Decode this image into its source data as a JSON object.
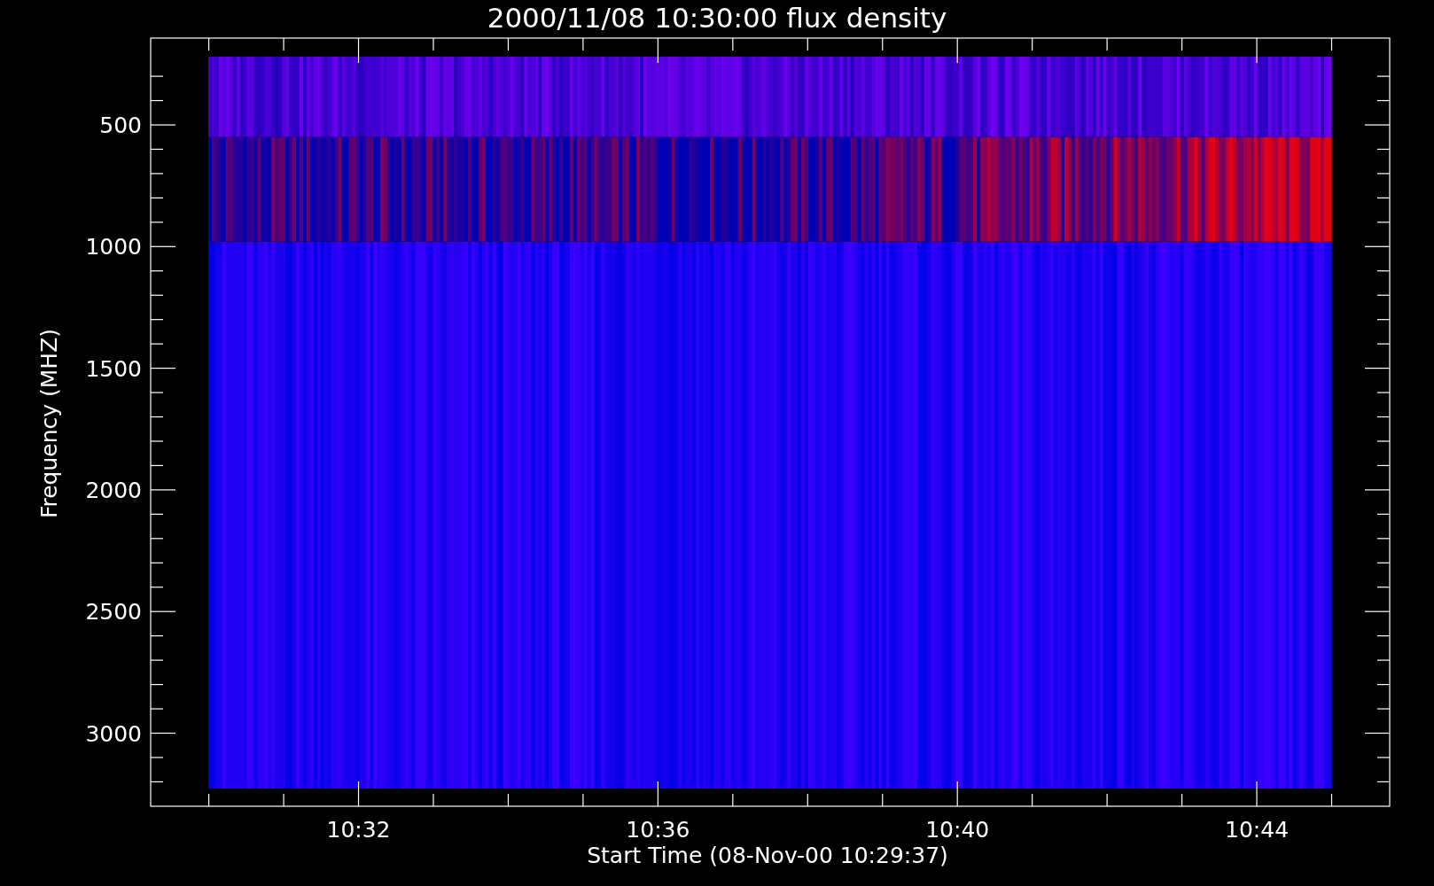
{
  "title": "2000/11/08 10:30:00 flux density",
  "y_axis": {
    "label": "Frequency (MHZ)",
    "ticks": [
      "500",
      "1000",
      "1500",
      "2000",
      "2500",
      "3000"
    ]
  },
  "x_axis": {
    "label": "Start Time (08-Nov-00 10:29:37)",
    "ticks": [
      "10:32",
      "10:36",
      "10:40",
      "10:44"
    ]
  }
}
